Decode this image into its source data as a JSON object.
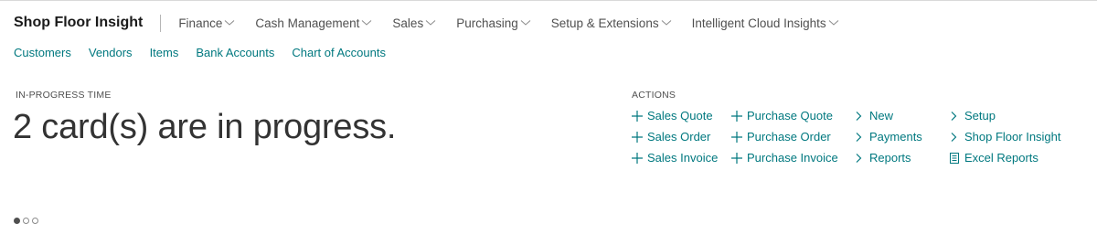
{
  "app": {
    "title": "Shop Floor Insight"
  },
  "menu": [
    {
      "label": "Finance"
    },
    {
      "label": "Cash Management"
    },
    {
      "label": "Sales"
    },
    {
      "label": "Purchasing"
    },
    {
      "label": "Setup & Extensions"
    },
    {
      "label": "Intelligent Cloud Insights"
    }
  ],
  "links": [
    {
      "label": "Customers"
    },
    {
      "label": "Vendors"
    },
    {
      "label": "Items"
    },
    {
      "label": "Bank Accounts"
    },
    {
      "label": "Chart of Accounts"
    }
  ],
  "cue": {
    "label": "IN-PROGRESS TIME",
    "text": "2 card(s) are in progress."
  },
  "actions": {
    "label": "ACTIONS",
    "columns": [
      [
        {
          "label": "Sales Quote",
          "icon": "plus-icon"
        },
        {
          "label": "Sales Order",
          "icon": "plus-icon"
        },
        {
          "label": "Sales Invoice",
          "icon": "plus-icon"
        }
      ],
      [
        {
          "label": "Purchase Quote",
          "icon": "plus-icon"
        },
        {
          "label": "Purchase Order",
          "icon": "plus-icon"
        },
        {
          "label": "Purchase Invoice",
          "icon": "plus-icon"
        }
      ],
      [
        {
          "label": "New",
          "icon": "chevron-right-icon"
        },
        {
          "label": "Payments",
          "icon": "chevron-right-icon"
        },
        {
          "label": "Reports",
          "icon": "chevron-right-icon"
        }
      ],
      [
        {
          "label": "Setup",
          "icon": "chevron-right-icon"
        },
        {
          "label": "Shop Floor Insight",
          "icon": "chevron-right-icon"
        },
        {
          "label": "Excel Reports",
          "icon": "report-icon"
        }
      ]
    ]
  },
  "pager": {
    "count": 3,
    "active": 0
  },
  "colors": {
    "accent": "#00787f",
    "text": "#212121",
    "muted": "#505050"
  }
}
